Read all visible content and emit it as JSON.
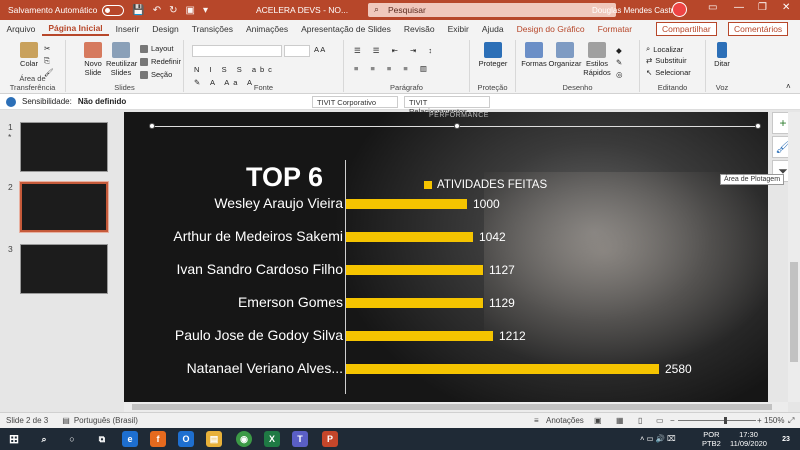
{
  "titlebar": {
    "autosave_label": "Salvamento Automático",
    "doc_title": "ACELERA DEVS - NO...",
    "search_placeholder": "Pesquisar",
    "user_name": "Douglas Mendes Castro"
  },
  "tabs": [
    "Arquivo",
    "Página Inicial",
    "Inserir",
    "Design",
    "Transições",
    "Animações",
    "Apresentação de Slides",
    "Revisão",
    "Exibir",
    "Ajuda",
    "Design do Gráfico",
    "Formatar"
  ],
  "tab_share": "Compartilhar",
  "tab_comments": "Comentários",
  "ribbon": {
    "clipboard": {
      "name": "Área de Transferência",
      "paste": "Colar"
    },
    "slides": {
      "name": "Slides",
      "new_slide": "Novo Slide",
      "reuse": "Reutilizar Slides",
      "layout": "Layout",
      "reset": "Redefinir",
      "section": "Seção"
    },
    "font": {
      "name": "Fonte"
    },
    "paragraph": {
      "name": "Parágrafo"
    },
    "protection": {
      "name": "Proteção",
      "protect": "Proteger"
    },
    "drawing": {
      "name": "Desenho",
      "shapes": "Formas",
      "arrange": "Organizar",
      "styles": "Estilos Rápidos"
    },
    "editing": {
      "name": "Editando",
      "find": "Localizar",
      "replace": "Substituir",
      "select": "Selecionar"
    },
    "voice": {
      "name": "Voz",
      "dictate": "Ditar"
    }
  },
  "sensitivity": {
    "label": "Sensibilidade:",
    "value": "Não definido",
    "tag1": "TIVIT Corporativo",
    "tag2": "TIVIT Relacionamentos"
  },
  "thumbnails": [
    {
      "num": "1",
      "star": "*"
    },
    {
      "num": "2"
    },
    {
      "num": "3"
    }
  ],
  "slide": {
    "header_partial": "PERFORMANCE",
    "heading": "TOP 6",
    "tooltip": "Área de Plotagem"
  },
  "chart_data": {
    "type": "bar",
    "orientation": "horizontal",
    "categories": [
      "Wesley Araujo Vieira",
      "Arthur de Medeiros Sakemi",
      "Ivan Sandro Cardoso Filho",
      "Emerson Gomes",
      "Paulo Jose de Godoy Silva",
      "Natanael Veriano Alves..."
    ],
    "series": [
      {
        "name": "ATIVIDADES FEITAS",
        "values": [
          1000,
          1042,
          1127,
          1129,
          1212,
          2580
        ]
      }
    ],
    "title": "",
    "xlabel": "",
    "ylabel": "",
    "xlim": [
      0,
      2800
    ],
    "bar_color": "#f5c400",
    "legend": "top",
    "grid": false
  },
  "status": {
    "slide_info": "Slide 2 de 3",
    "language": "Português (Brasil)",
    "notes": "Anotações",
    "zoom": "150%"
  },
  "taskbar": {
    "lang": "POR",
    "layout": "PTB2",
    "time": "17:30",
    "date": "11/09/2020",
    "notif": "23"
  }
}
